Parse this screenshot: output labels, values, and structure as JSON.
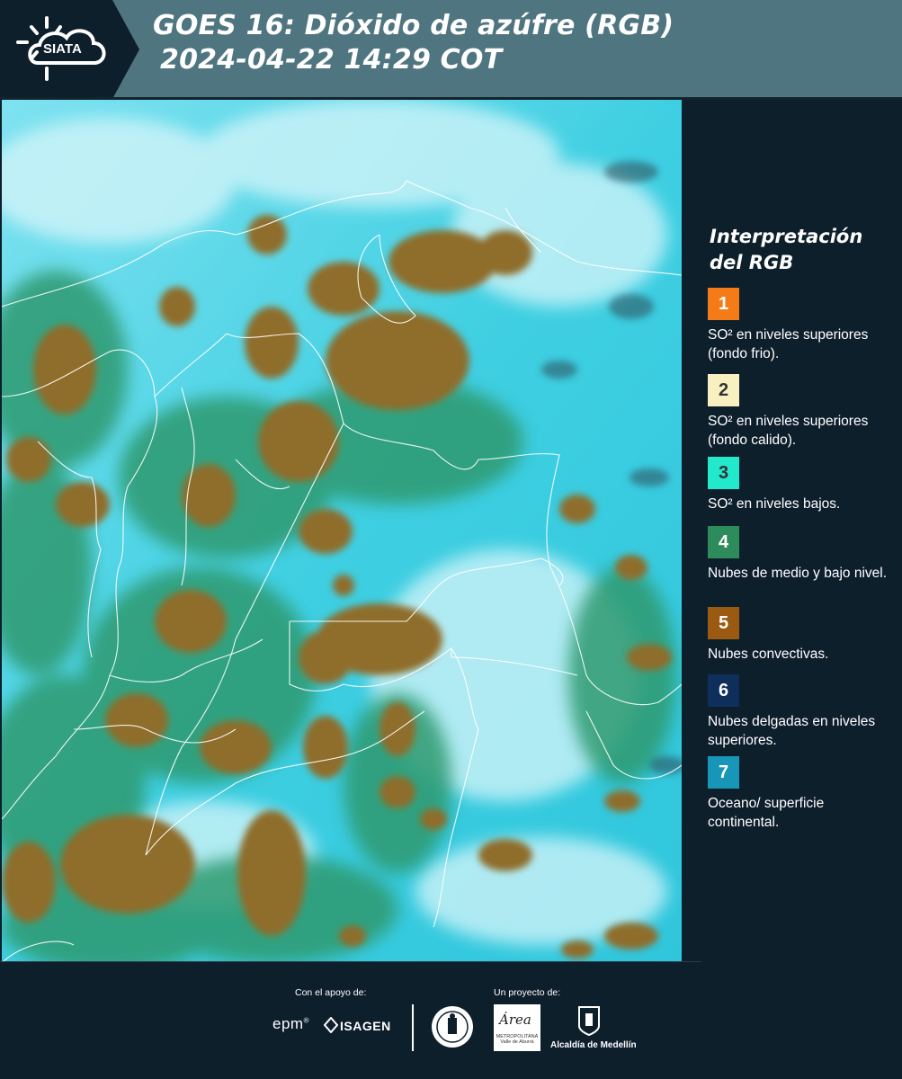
{
  "header": {
    "logo_text": "SIATA",
    "title_line1": "GOES 16: Dióxido de azúfre (RGB)",
    "title_line2": "2024-04-22 14:29 COT",
    "background": "#4f7581"
  },
  "legend": {
    "title": "Interpretación del RGB",
    "items": [
      {
        "number": "1",
        "color": "#f47b17",
        "text": "SO² en niveles superiores (fondo frio)."
      },
      {
        "number": "2",
        "color": "#f8f0c0",
        "text": "SO² en niveles superiores (fondo calido)."
      },
      {
        "number": "3",
        "color": "#22e8cc",
        "text": "SO² en niveles bajos."
      },
      {
        "number": "4",
        "color": "#2e8c5c",
        "text": "Nubes de medio y bajo nivel."
      },
      {
        "number": "5",
        "color": "#9a5a12",
        "text": "Nubes convectivas."
      },
      {
        "number": "6",
        "color": "#0e2f5c",
        "text": "Nubes delgadas en niveles superiores."
      },
      {
        "number": "7",
        "color": "#1796b8",
        "text": "Oceano/ superficie continental."
      }
    ]
  },
  "footer": {
    "support_label": "Con el apoyo de:",
    "project_label": "Un proyecto de:",
    "sponsor_1": "epm",
    "sponsor_1_mark": "®",
    "sponsor_2": "ISAGEN",
    "area_logo": "Área",
    "area_logo_sub": "METROPOLITANA Valle de Aburrá",
    "alcaldia": "Alcaldía de Medellín"
  },
  "colors": {
    "ocean_cyan": "#34cbe0",
    "cloud_brown": "#8f7028",
    "cloud_green": "#33a070",
    "panel_dark": "#0e1f2c"
  }
}
